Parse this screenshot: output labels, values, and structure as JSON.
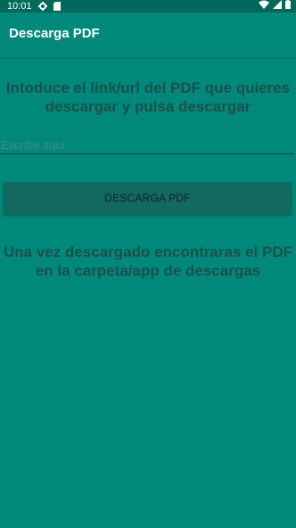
{
  "status_bar": {
    "time": "10:01",
    "icons": [
      "gear-icon",
      "sd-card-icon",
      "wifi-icon",
      "signal-icon",
      "battery-icon"
    ]
  },
  "app_bar": {
    "title": "Descarga PDF"
  },
  "main": {
    "instructions_line1": "Intoduce el link/url del PDF que quieres",
    "instructions_line2": "descargar y pulsa descargar",
    "url_placeholder": "Escribe aquí",
    "download_button_label": "DESCARGA PDF",
    "result_line1": "Una vez descargado encontraras el PDF",
    "result_line2": "en la carpeta/app de descargas"
  },
  "colors": {
    "background": "#00897b",
    "status_bar": "#00695c",
    "button": "#11695f",
    "text_dark": "#1d4f4a"
  }
}
